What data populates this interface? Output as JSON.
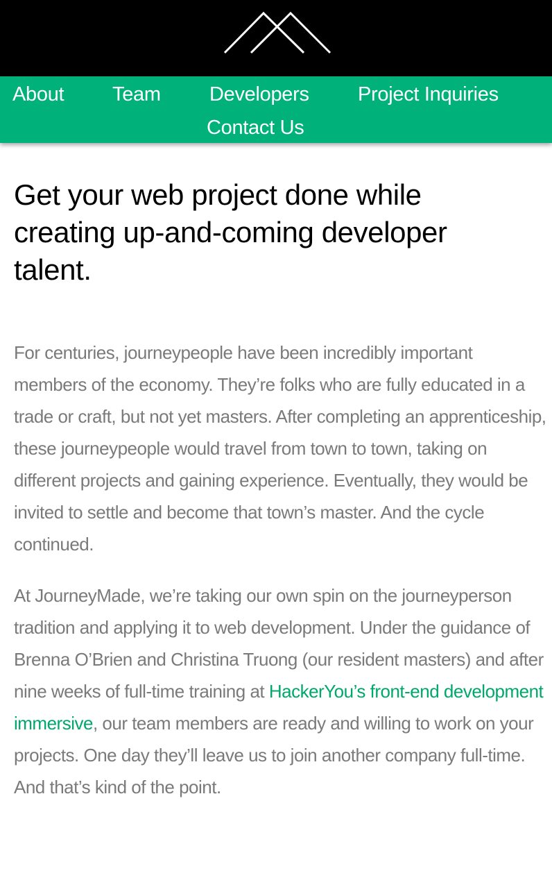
{
  "header": {
    "logo_icon": "mountain-peaks-logo"
  },
  "nav": {
    "items": [
      {
        "label": "About"
      },
      {
        "label": "Team"
      },
      {
        "label": "Developers"
      },
      {
        "label": "Project Inquiries"
      },
      {
        "label": "Contact Us"
      }
    ]
  },
  "main": {
    "headline": "Get your web project done while creating up-and-coming developer talent.",
    "paragraph1": "For centuries, journeypeople have been incredibly important members of the economy. They’re folks who are fully educated in a trade or craft, but not yet masters. After completing an apprenticeship, these journeypeople would travel from town to town, taking on different projects and gaining experience. Eventually, they would be invited to settle and become that town’s master. And the cycle continued.",
    "paragraph2_before_link": "At JourneyMade, we’re taking our own spin on the journeyperson tradition and applying it to web development. Under the guidance of Brenna O’Brien and Christina Truong (our resident masters) and after nine weeks of full-time training at ",
    "paragraph2_link": "HackerYou’s front-end development immersive",
    "paragraph2_after_link": ", our team members are ready and willing to work on your projects. One day they’ll leave us to join another company full-time. And that’s kind of the point."
  },
  "colors": {
    "header_bg": "#000000",
    "nav_bg": "#00b27a",
    "nav_text": "#ffffff",
    "body_text": "#7a7a7a",
    "link": "#00a86b",
    "headline": "#000000"
  }
}
